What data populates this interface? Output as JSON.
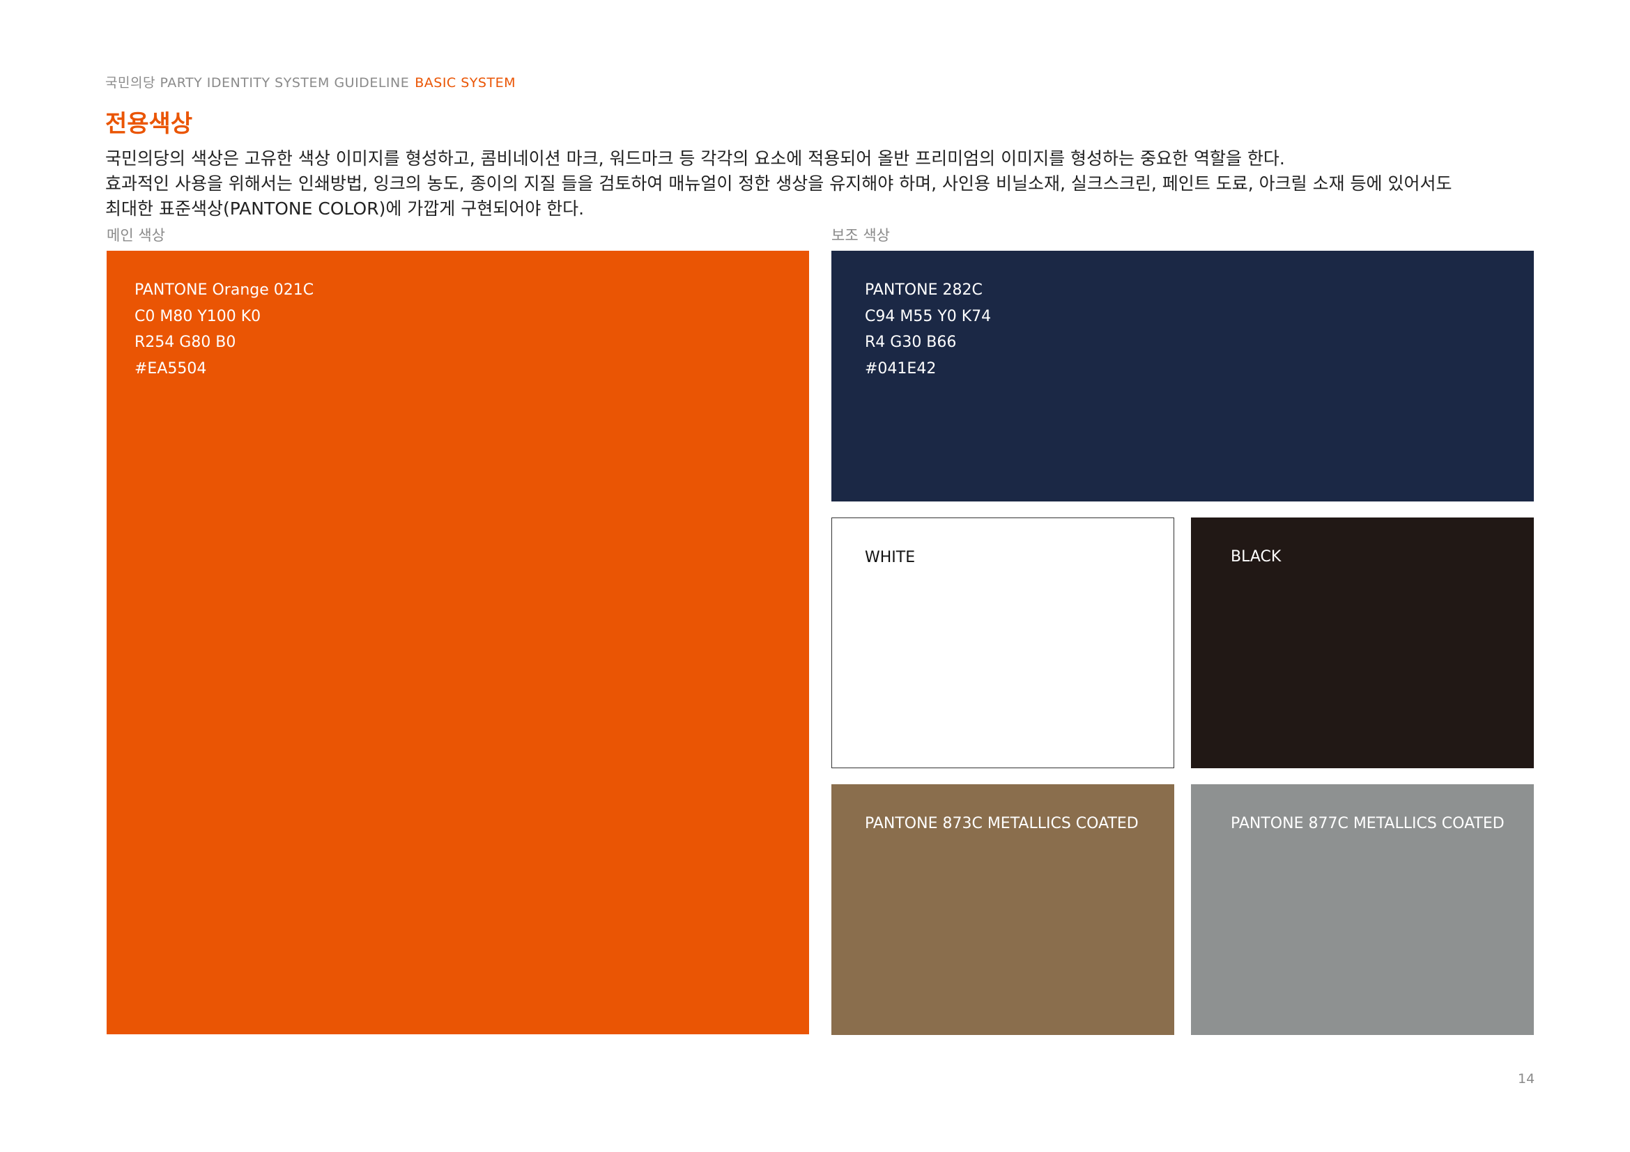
{
  "header": {
    "guide_title": "국민의당 PARTY IDENTITY SYSTEM GUIDELINE",
    "section": "BASIC SYSTEM"
  },
  "page_title": "전용색상",
  "intro": {
    "line1": "국민의당의 색상은 고유한 색상 이미지를 형성하고, 콤비네이션 마크, 워드마크 등 각각의 요소에 적용되어 올반 프리미엄의 이미지를 형성하는 중요한 역할을 한다.",
    "line2": "효과적인 사용을 위해서는 인쇄방법, 잉크의 농도, 종이의 지질 들을 검토하여 매뉴얼이 정한 생상을 유지해야 하며, 사인용 비닐소재, 실크스크린, 페인트 도료, 아크릴 소재 등에 있어서도",
    "line3": "최대한 표준색상(PANTONE COLOR)에 가깝게 구현되어야 한다."
  },
  "main_colors": {
    "label": "메인 색상",
    "orange": {
      "color": "#EA5504",
      "name": "PANTONE Orange 021C",
      "cmyk": "C0 M80 Y100 K0",
      "rgb": "R254 G80 B0",
      "hex": "#EA5504"
    }
  },
  "sub_colors": {
    "label": "보조 색상",
    "navy": {
      "color": "#1B2845",
      "name": "PANTONE 282C",
      "cmyk": "C94 M55 Y0 K74",
      "rgb": "R4 G30 B66",
      "hex": "#041E42"
    },
    "white": {
      "color": "#FFFFFF",
      "name": "WHITE"
    },
    "black": {
      "color": "#211815",
      "name": "BLACK"
    },
    "gold": {
      "color": "#8A6E4D",
      "name": "PANTONE 873C METALLICS COATED"
    },
    "silver": {
      "color": "#8E9191",
      "name": "PANTONE 877C METALLICS COATED"
    }
  },
  "page_number": "14"
}
